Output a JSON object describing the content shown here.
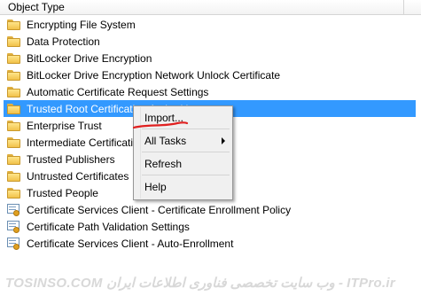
{
  "header": {
    "column_title": "Object Type"
  },
  "items": [
    {
      "label": "Encrypting File System",
      "icon": "folder-icon"
    },
    {
      "label": "Data Protection",
      "icon": "folder-icon"
    },
    {
      "label": "BitLocker Drive Encryption",
      "icon": "folder-icon"
    },
    {
      "label": "BitLocker Drive Encryption Network Unlock Certificate",
      "icon": "folder-icon"
    },
    {
      "label": "Automatic Certificate Request Settings",
      "icon": "folder-icon"
    },
    {
      "label": "Trusted Root Certification Authorities",
      "icon": "folder-icon",
      "selected": true
    },
    {
      "label": "Enterprise Trust",
      "icon": "folder-icon"
    },
    {
      "label": "Intermediate Certification Authorities",
      "icon": "folder-icon"
    },
    {
      "label": "Trusted Publishers",
      "icon": "folder-icon"
    },
    {
      "label": "Untrusted Certificates",
      "icon": "folder-icon"
    },
    {
      "label": "Trusted People",
      "icon": "folder-icon"
    },
    {
      "label": "Certificate Services Client - Certificate Enrollment Policy",
      "icon": "certificate-icon"
    },
    {
      "label": "Certificate Path Validation Settings",
      "icon": "certificate-icon"
    },
    {
      "label": "Certificate Services Client - Auto-Enrollment",
      "icon": "certificate-icon"
    }
  ],
  "context_menu": {
    "import": "Import...",
    "all_tasks": "All Tasks",
    "refresh": "Refresh",
    "help": "Help"
  },
  "watermark": {
    "text": "TOSINSO.COM وب سایت تخصصی فناوری اطلاعات ایران - ITPro.ir"
  },
  "colors": {
    "selection": "#3399ff",
    "annotation": "#e02020"
  }
}
